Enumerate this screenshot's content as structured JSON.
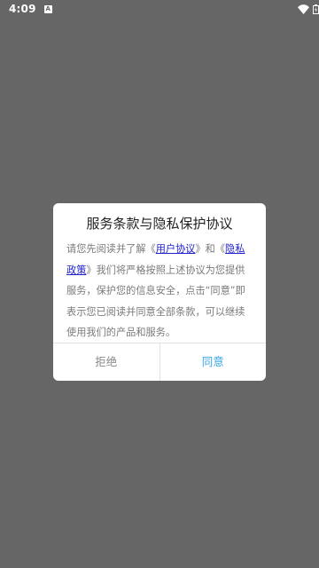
{
  "status_bar": {
    "time": "4:09",
    "app_icon_letter": "A",
    "icons": [
      "wifi-icon",
      "battery-icon"
    ]
  },
  "dialog": {
    "title": "服务条款与隐私保护协议",
    "body": {
      "intro": "请您先阅读并了解《",
      "user_agreement_link": "用户协议",
      "mid": "》和《",
      "privacy_policy_link": "隐私政策",
      "rest": "》我们将严格按照上述协议为您提供服务，保护您的信息安全，点击“同意”即表示您已阅读并同意全部条款，可以继续使用我们的产品和服务。"
    },
    "refuse_label": "拒绝",
    "agree_label": "同意"
  },
  "colors": {
    "overlay": "#666666",
    "link": "#2020cc",
    "agree": "#37a6e6",
    "refuse": "#8a8a8a"
  }
}
